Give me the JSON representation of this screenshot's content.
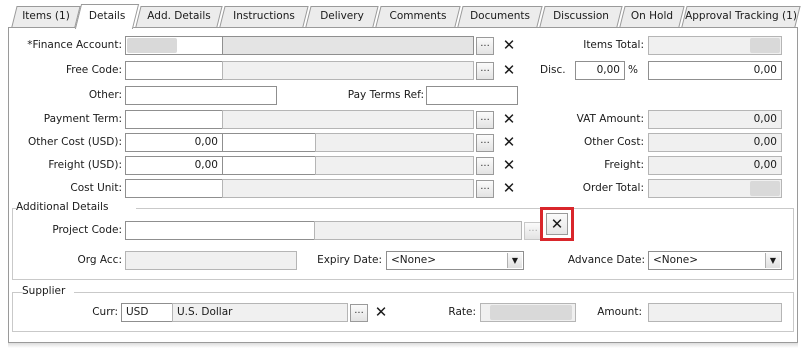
{
  "tabs": [
    {
      "label": "Items (1)",
      "active": false
    },
    {
      "label": "Details",
      "active": true
    },
    {
      "label": "Add. Details",
      "active": false
    },
    {
      "label": "Instructions",
      "active": false
    },
    {
      "label": "Delivery",
      "active": false
    },
    {
      "label": "Comments",
      "active": false
    },
    {
      "label": "Documents",
      "active": false
    },
    {
      "label": "Discussion",
      "active": false
    },
    {
      "label": "On Hold",
      "active": false
    },
    {
      "label": "Approval Tracking (1)",
      "active": false
    }
  ],
  "form": {
    "finance_account_label": "*Finance Account:",
    "free_code_label": "Free Code:",
    "other_label": "Other:",
    "pay_terms_ref_label": "Pay Terms Ref:",
    "payment_term_label": "Payment Term:",
    "other_cost_label": "Other Cost (USD):",
    "other_cost_value": "0,00",
    "freight_label": "Freight (USD):",
    "freight_value": "0,00",
    "cost_unit_label": "Cost Unit:",
    "ellipsis": "...",
    "clear_glyph": "✕"
  },
  "totals": {
    "items_total_label": "Items Total:",
    "disc_label": "Disc.",
    "disc_percent": "0,00",
    "percent_sign": "%",
    "disc_amount": "0,00",
    "vat_amount_label": "VAT Amount:",
    "vat_amount_value": "0,00",
    "other_cost_label": "Other Cost:",
    "other_cost_value": "0,00",
    "freight_label": "Freight:",
    "freight_value": "0,00",
    "order_total_label": "Order Total:"
  },
  "additional": {
    "group_label": "Additional Details",
    "project_code_label": "Project Code:",
    "org_acc_label": "Org Acc:",
    "expiry_date_label": "Expiry Date:",
    "expiry_date_value": "<None>",
    "advance_date_label": "Advance Date:",
    "advance_date_value": "<None>"
  },
  "supplier": {
    "group_label": "Supplier",
    "curr_label": "Curr:",
    "curr_code": "USD",
    "curr_name": "U.S. Dollar",
    "rate_label": "Rate:",
    "amount_label": "Amount:"
  },
  "colors": {
    "highlight": "#d9262b"
  }
}
